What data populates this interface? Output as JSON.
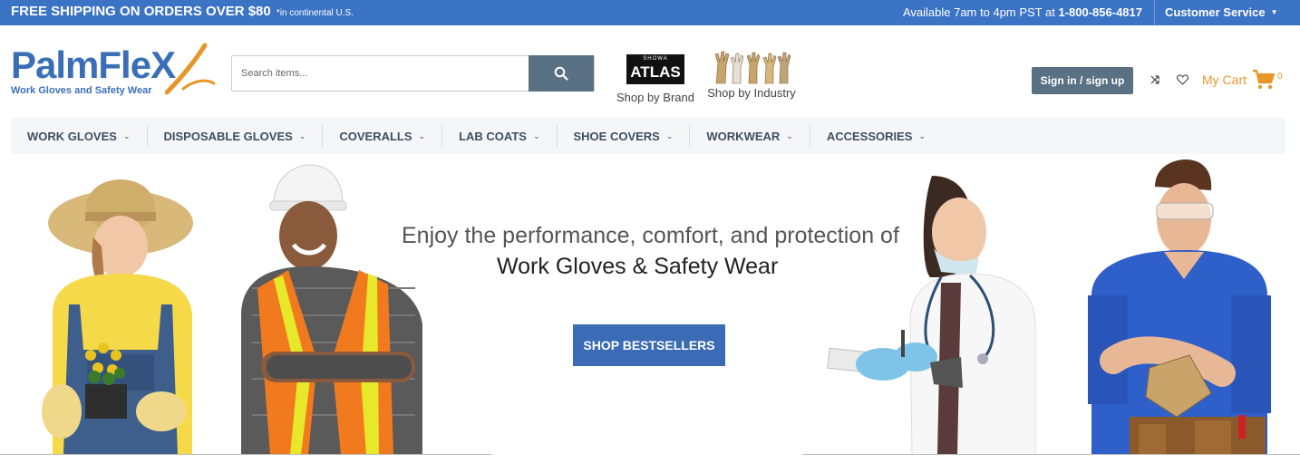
{
  "topbar": {
    "promo": "FREE SHIPPING ON ORDERS OVER $80",
    "promo_note": "*in continental U.S.",
    "hours": "Available 7am to 4pm PST at",
    "phone": "1-800-856-4817",
    "customer_service": "Customer Service",
    "bg_color": "#3b73c5"
  },
  "logo": {
    "name_part1": "PalmFle",
    "name_part2": "X",
    "tagline": "Work Gloves and Safety Wear"
  },
  "search": {
    "placeholder": "Search items...",
    "value": "",
    "button_icon": "search-icon"
  },
  "brand_link": {
    "logo_small": "SHOWA",
    "logo_main": "ATLAS",
    "label": "Shop by Brand"
  },
  "industry_link": {
    "label": "Shop by Industry"
  },
  "account": {
    "signin_label": "Sign in / sign up",
    "compare_icon": "compare-arrows-icon",
    "wishlist_icon": "heart-icon",
    "cart_label": "My Cart",
    "cart_count": "0",
    "accent_color": "#e8952a"
  },
  "nav": {
    "items": [
      {
        "label": "WORK GLOVES"
      },
      {
        "label": "DISPOSABLE GLOVES"
      },
      {
        "label": "COVERALLS"
      },
      {
        "label": "LAB COATS"
      },
      {
        "label": "SHOE COVERS"
      },
      {
        "label": "WORKWEAR"
      },
      {
        "label": "ACCESSORIES"
      }
    ]
  },
  "hero": {
    "headline_line1": "Enjoy the performance, comfort, and protection of",
    "headline_line2": "Work Gloves & Safety Wear",
    "cta_label": "SHOP BESTSELLERS",
    "cta_color": "#3b6bb5"
  }
}
